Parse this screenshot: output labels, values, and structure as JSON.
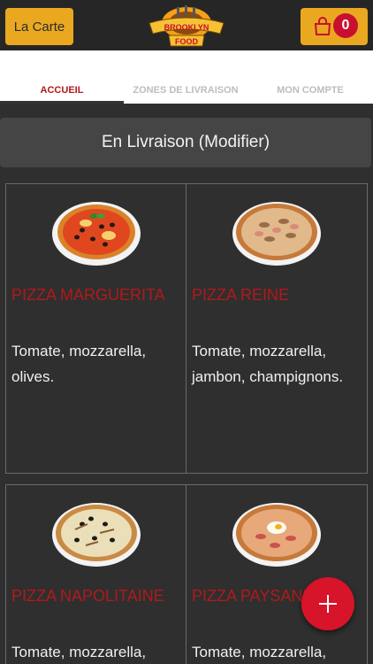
{
  "header": {
    "menu_label": "La Carte",
    "cart_count": "0",
    "logo_text_top": "BROOKLYN",
    "logo_text_bottom": "FOOD"
  },
  "tabs": [
    {
      "label": "ACCUEIL",
      "active": true
    },
    {
      "label": "ZONES DE LIVRAISON",
      "active": false
    },
    {
      "label": "MON COMPTE",
      "active": false
    }
  ],
  "delivery_mode": "En Livraison (Modifier)",
  "products": [
    {
      "name": "PIZZA MARGUERITA",
      "description": "Tomate, mozzarella, olives.",
      "topping": "olives-basil"
    },
    {
      "name": "PIZZA REINE",
      "description": "Tomate, mozzarella, jambon, champignons.",
      "topping": "ham-mushroom"
    },
    {
      "name": "PIZZA NAPOLITAINE",
      "description": "Tomate, mozzarella,",
      "topping": "anchovy-olive"
    },
    {
      "name": "PIZZA PAYSANNE",
      "description": "Tomate, mozzarella,",
      "topping": "egg-bacon"
    }
  ],
  "colors": {
    "accent": "#e9a820",
    "brand_red": "#b2191b",
    "fab_red": "#d8142a",
    "background": "#2f2f2f"
  },
  "fab_icon": "plus-icon"
}
